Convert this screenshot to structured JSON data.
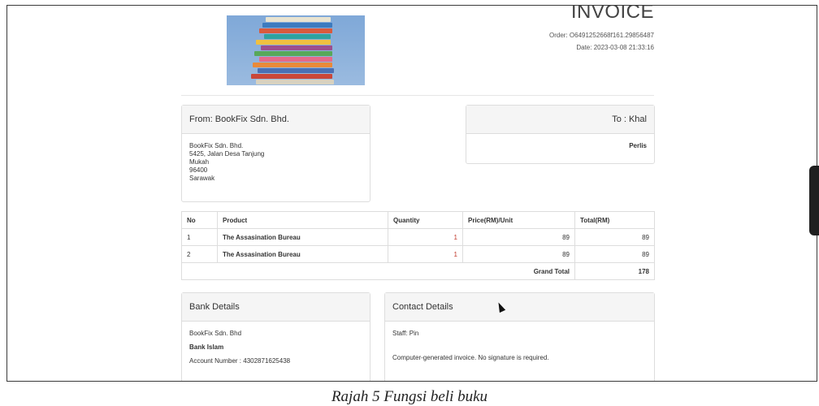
{
  "invoice": {
    "title": "INVOICE",
    "order": "Order: O6491252668f161.29856487",
    "date": "Date: 2023-03-08 21:33:16"
  },
  "from": {
    "heading": "From: BookFix Sdn. Bhd.",
    "lines": [
      "BookFix Sdn. Bhd.",
      "5425, Jalan Desa Tanjung",
      "Mukah",
      "96400",
      "Sarawak"
    ]
  },
  "to": {
    "heading": "To : Khal",
    "lines": [
      "Perlis"
    ]
  },
  "table": {
    "headers": [
      "No",
      "Product",
      "Quantity",
      "Price(RM)/Unit",
      "Total(RM)"
    ],
    "rows": [
      {
        "no": "1",
        "product": "The Assasination Bureau",
        "qty": "1",
        "price": "89",
        "total": "89"
      },
      {
        "no": "2",
        "product": "The Assasination Bureau",
        "qty": "1",
        "price": "89",
        "total": "89"
      }
    ],
    "grand_total_label": "Grand Total",
    "grand_total": "178"
  },
  "bank": {
    "heading": "Bank Details",
    "lines": [
      "BookFix Sdn. Bhd",
      "Bank Islam",
      "Account Number : 4302871625438"
    ]
  },
  "contact": {
    "heading": "Contact Details",
    "staff": "Staff: Pin",
    "note": "Computer-generated invoice. No signature is required."
  },
  "caption": "Rajah 5 Fungsi beli buku",
  "colors": {
    "quantity_text": "#c0392b",
    "panel_header_bg": "#f5f5f5"
  }
}
